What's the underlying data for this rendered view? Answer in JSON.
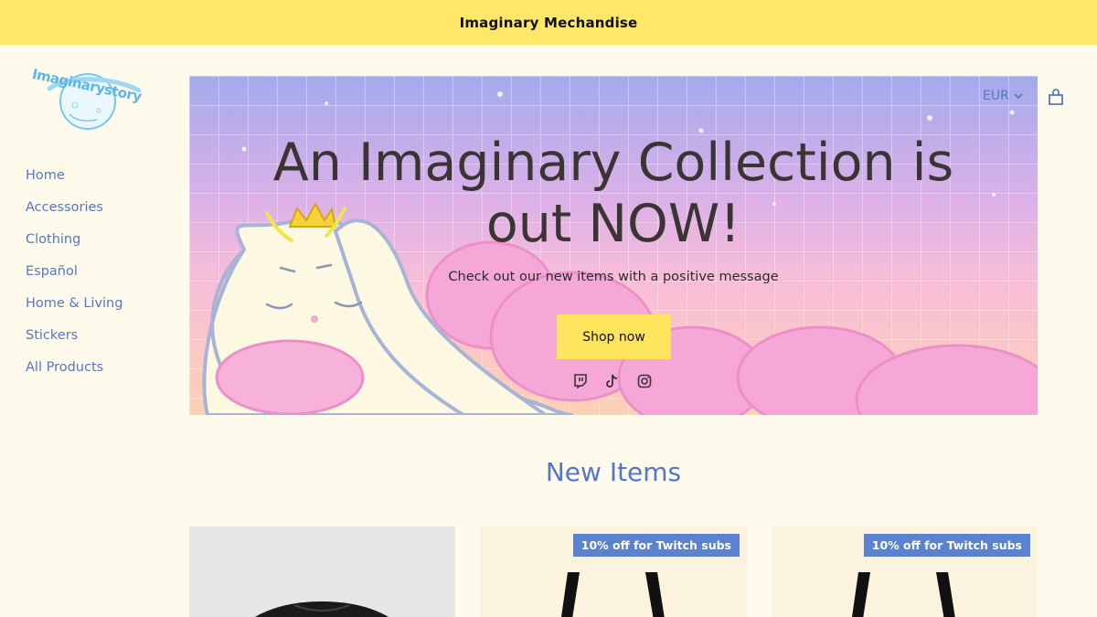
{
  "announcement": {
    "text": "Imaginary Mechandise"
  },
  "logo": {
    "text": "Imaginarystory"
  },
  "nav": {
    "items": [
      {
        "label": "Home"
      },
      {
        "label": "Accessories"
      },
      {
        "label": "Clothing"
      },
      {
        "label": "Español"
      },
      {
        "label": "Home & Living"
      },
      {
        "label": "Stickers"
      },
      {
        "label": "All Products"
      }
    ]
  },
  "header": {
    "currency": "EUR",
    "cart_icon": "shopping-bag-icon"
  },
  "hero": {
    "title_line1": "An Imaginary Collection is",
    "title_line2": "out NOW!",
    "subtitle": "Check out our new items with a positive message",
    "button_label": "Shop now",
    "socials": [
      "twitch-icon",
      "tiktok-icon",
      "instagram-icon"
    ]
  },
  "section": {
    "title": "New Items"
  },
  "products": [
    {
      "badge": ""
    },
    {
      "badge": "10% off for Twitch subs"
    },
    {
      "badge": "10% off for Twitch subs"
    }
  ],
  "colors": {
    "accent": "#5576c3",
    "announcement_bg": "#ffe76a",
    "button_bg": "#ffe45e",
    "badge_bg": "#5a82cf",
    "page_bg": "#fefbec"
  }
}
